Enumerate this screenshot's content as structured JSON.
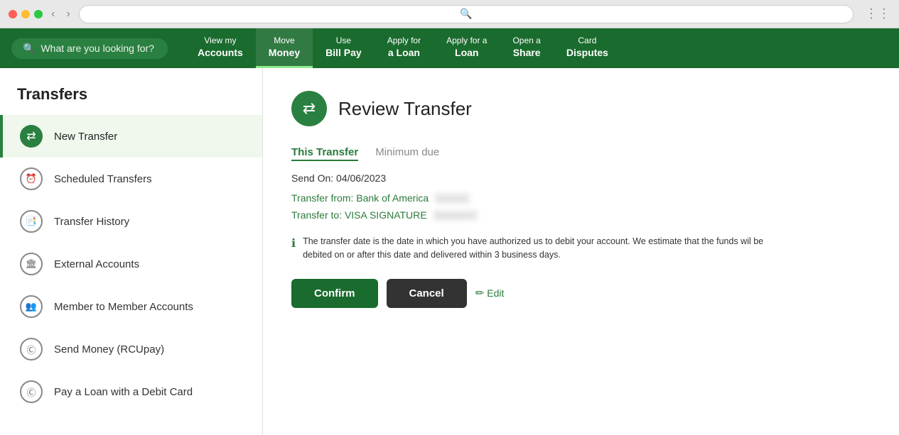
{
  "browser": {
    "url_placeholder": ""
  },
  "nav": {
    "search_placeholder": "What are you looking for?",
    "items": [
      {
        "id": "view-accounts",
        "top": "View my",
        "bottom": "Accounts",
        "active": false
      },
      {
        "id": "move-money",
        "top": "Move",
        "bottom": "Money",
        "active": true
      },
      {
        "id": "bill-pay",
        "top": "Use",
        "bottom": "Bill Pay",
        "active": false
      },
      {
        "id": "apply-loan",
        "top": "Apply for",
        "bottom": "a Loan",
        "active": false
      },
      {
        "id": "apply-loan2",
        "top": "Apply for a",
        "bottom": "Loan",
        "active": false
      },
      {
        "id": "open-share",
        "top": "Open a",
        "bottom": "Share",
        "active": false
      },
      {
        "id": "card-disputes",
        "top": "Card",
        "bottom": "Disputes",
        "active": false
      }
    ]
  },
  "sidebar": {
    "title": "Transfers",
    "items": [
      {
        "id": "new-transfer",
        "label": "New Transfer",
        "icon_type": "circle-green",
        "icon": "⇄",
        "active": true
      },
      {
        "id": "scheduled-transfers",
        "label": "Scheduled Transfers",
        "icon_type": "circle-gray",
        "icon": "⏱",
        "active": false
      },
      {
        "id": "transfer-history",
        "label": "Transfer History",
        "icon_type": "circle-gray",
        "icon": "🗒",
        "active": false
      },
      {
        "id": "external-accounts",
        "label": "External Accounts",
        "icon_type": "circle-gray",
        "icon": "🏛",
        "active": false
      },
      {
        "id": "member-to-member",
        "label": "Member to Member Accounts",
        "icon_type": "circle-gray",
        "icon": "👥",
        "active": false
      },
      {
        "id": "send-money",
        "label": "Send Money (RCUpay)",
        "icon_type": "circle-gray",
        "icon": "💳",
        "active": false
      },
      {
        "id": "pay-loan",
        "label": "Pay a Loan with a Debit Card",
        "icon_type": "circle-gray",
        "icon": "💳",
        "active": false
      }
    ]
  },
  "content": {
    "page_icon": "⇄",
    "page_title": "Review Transfer",
    "tab_this_transfer": "This Transfer",
    "tab_minimum_due": "Minimum due",
    "send_on_label": "Send On:",
    "send_on_date": "04/06/2023",
    "transfer_from_label": "Transfer from: Bank of America",
    "transfer_from_account": "••••••",
    "transfer_to_label": "Transfer to: VISA SIGNATURE",
    "transfer_to_account": "••••••••",
    "info_text": "The transfer date is the date in which you have authorized us to debit your account. We estimate that the funds wil be debited on or after this date and delivered within 3 business days.",
    "btn_confirm": "Confirm",
    "btn_cancel": "Cancel",
    "btn_edit": "Edit"
  }
}
